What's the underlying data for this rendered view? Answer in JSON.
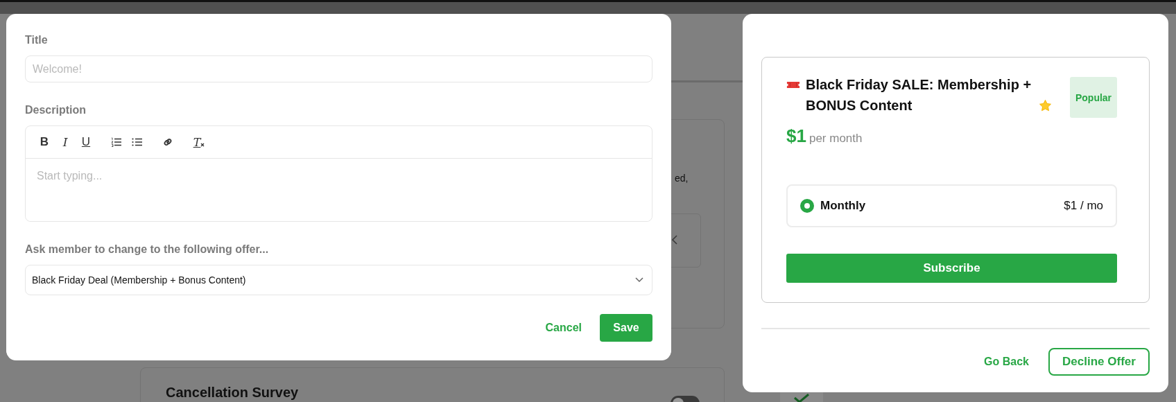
{
  "background": {
    "fragment_text": "ed,",
    "survey_title": "Cancellation Survey",
    "survey_toggle_on": false
  },
  "editor_modal": {
    "title_field": {
      "label": "Title",
      "placeholder": "Welcome!"
    },
    "description_field": {
      "label": "Description",
      "placeholder": "Start typing...",
      "toolbar": [
        {
          "kind": "bold",
          "label": "B"
        },
        {
          "kind": "italic",
          "label": "I"
        },
        {
          "kind": "underline",
          "label": "U"
        },
        {
          "kind": "ordered-list"
        },
        {
          "kind": "bullet-list"
        },
        {
          "kind": "link"
        },
        {
          "kind": "clear-format",
          "label": "T"
        }
      ]
    },
    "offer_field": {
      "label": "Ask member to change to the following offer...",
      "value": "Black Friday Deal (Membership + Bonus Content)"
    },
    "buttons": {
      "cancel": "Cancel",
      "save": "Save"
    }
  },
  "offer_modal": {
    "title": "Black Friday SALE: Membership + BONUS Content",
    "badge": "Popular",
    "price": "$1",
    "price_period": "per month",
    "plans": [
      {
        "name": "Monthly",
        "price": "$1 / mo",
        "selected": true
      }
    ],
    "subscribe": "Subscribe",
    "buttons": {
      "back": "Go Back",
      "decline": "Decline Offer"
    }
  }
}
